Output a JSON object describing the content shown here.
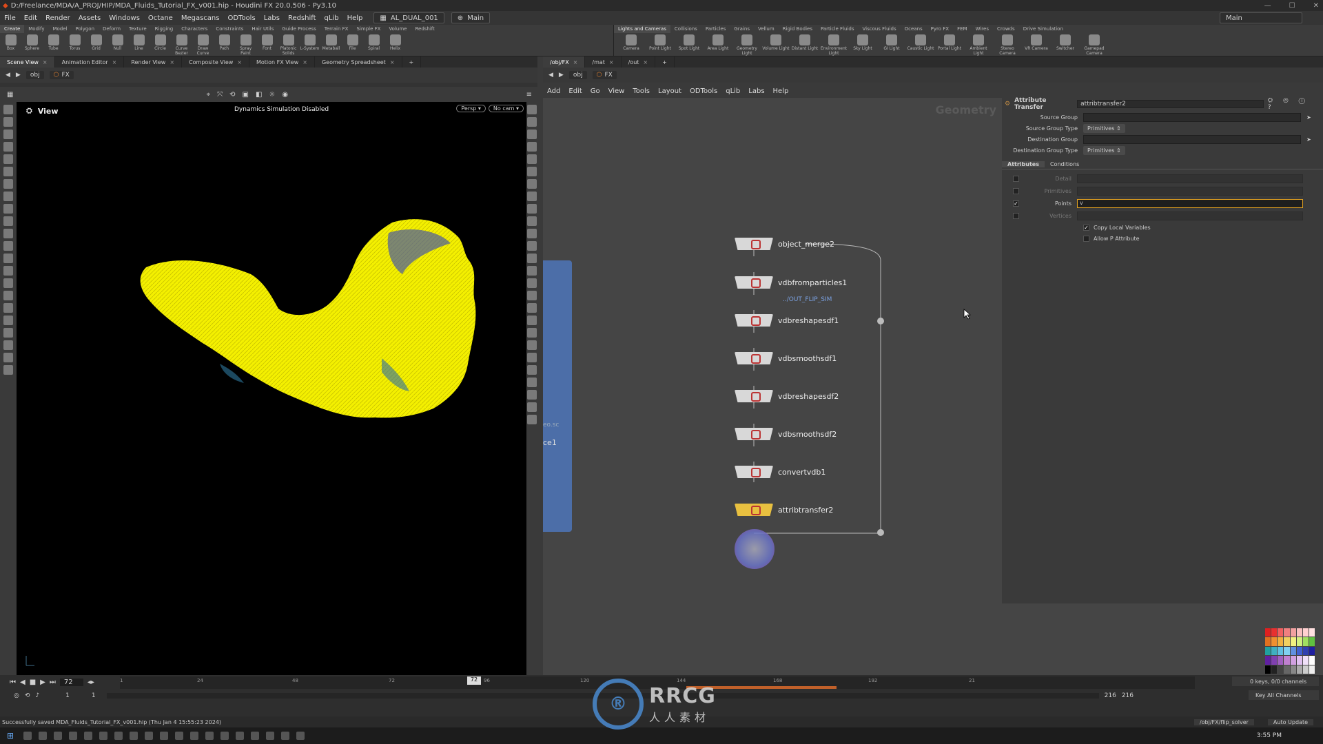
{
  "window": {
    "title": "D:/Freelance/MDA/A_PROJ/HIP/MDA_Fluids_Tutorial_FX_v001.hip - Houdini FX 20.0.506 - Py3.10"
  },
  "menubar": {
    "items": [
      "File",
      "Edit",
      "Render",
      "Assets",
      "Windows",
      "Octane",
      "Megascans",
      "ODTools",
      "Labs",
      "Redshift",
      "qLib",
      "Help"
    ],
    "desktop": "AL_DUAL_001",
    "context": "Main",
    "right_context": "Main"
  },
  "shelf": {
    "left_tabs": [
      "Create",
      "Modify",
      "Model",
      "Polygon",
      "Deform",
      "Texture",
      "Rigging",
      "Characters",
      "Constraints",
      "Hair Utils",
      "Guide Process",
      "Terrain FX",
      "Simple FX",
      "Volume",
      "Redshift"
    ],
    "left_tools": [
      "Box",
      "Sphere",
      "Tube",
      "Torus",
      "Grid",
      "Null",
      "Line",
      "Circle",
      "Curve Bezier",
      "Draw Curve",
      "Path",
      "Spray Paint",
      "Font",
      "Platonic Solids",
      "L-System",
      "Metaball",
      "File",
      "Spiral",
      "Helix"
    ],
    "right_tabs": [
      "Lights and Cameras",
      "Collisions",
      "Particles",
      "Grains",
      "Vellum",
      "Rigid Bodies",
      "Particle Fluids",
      "Viscous Fluids",
      "Oceans",
      "Pyro FX",
      "FEM",
      "Wires",
      "Crowds",
      "Drive Simulation"
    ],
    "right_tools": [
      "Camera",
      "Point Light",
      "Spot Light",
      "Area Light",
      "Geometry Light",
      "Volume Light",
      "Distant Light",
      "Environment Light",
      "Sky Light",
      "GI Light",
      "Caustic Light",
      "Portal Light",
      "Ambient Light",
      "Stereo Camera",
      "VR Camera",
      "Switcher",
      "Gamepad Camera"
    ]
  },
  "left_pane": {
    "tabs": [
      "Scene View",
      "Animation Editor",
      "Render View",
      "Composite View",
      "Motion FX View",
      "Geometry Spreadsheet"
    ],
    "path": [
      "obj",
      "FX"
    ],
    "viewport_label": "View",
    "viewport_status": "Dynamics Simulation Disabled",
    "persp": "Persp",
    "cam": "No cam"
  },
  "right_pane": {
    "tabs": [
      "/obj/FX",
      "/mat",
      "/out"
    ],
    "path": [
      "obj",
      "FX"
    ],
    "menu": [
      "Add",
      "Edit",
      "Go",
      "View",
      "Tools",
      "Layout",
      "ODTools",
      "qLib",
      "Labs",
      "Help"
    ],
    "watermark": "Geometry",
    "partial_labels": [
      "eo.sc",
      "ce1"
    ]
  },
  "network": {
    "merge_path": "../OUT_FLIP_SIM",
    "nodes": [
      "object_merge2",
      "vdbfromparticles1",
      "vdbreshapesdf1",
      "vdbsmoothsdf1",
      "vdbreshapesdf2",
      "vdbsmoothsdf2",
      "convertvdb1",
      "attribtransfer2"
    ]
  },
  "params": {
    "node_type": "Attribute Transfer",
    "node_name": "attribtransfer2",
    "source_group_label": "Source Group",
    "source_group_type_label": "Source Group Type",
    "source_group_type": "Primitives",
    "dest_group_label": "Destination Group",
    "dest_group_type_label": "Destination Group Type",
    "dest_group_type": "Primitives",
    "tabs": [
      "Attributes",
      "Conditions"
    ],
    "attr_rows": [
      {
        "label": "Detail",
        "checked": false,
        "value": ""
      },
      {
        "label": "Primitives",
        "checked": false,
        "value": ""
      },
      {
        "label": "Points",
        "checked": true,
        "value": "v"
      },
      {
        "label": "Vertices",
        "checked": false,
        "value": ""
      }
    ],
    "copy_local": "Copy Local Variables",
    "allow_p": "Allow P Attribute",
    "check": "✓"
  },
  "timeline": {
    "current_frame": "72",
    "ticks": [
      "1",
      "24",
      "48",
      "72",
      "96",
      "120",
      "144",
      "168",
      "192",
      "21"
    ],
    "start": "1",
    "start2": "1",
    "end": "216",
    "end2": "216",
    "keys": "0 keys, 0/0 channels",
    "key_all": "Key All Channels",
    "auto_update": "Auto Update",
    "solver_path": "/obj/FX/flip_solver"
  },
  "status": {
    "message": "Successfully saved MDA_Fluids_Tutorial_FX_v001.hip (Thu Jan 4 15:55:23 2024)"
  },
  "taskbar": {
    "time": "3:55 PM"
  },
  "watermark_text": {
    "big": "RRCG",
    "small": "人人素材"
  },
  "colors": {
    "liquid": "#f4f000",
    "node_selected_glow": "#6a74c8",
    "accent_blue": "#4c6ea8"
  }
}
